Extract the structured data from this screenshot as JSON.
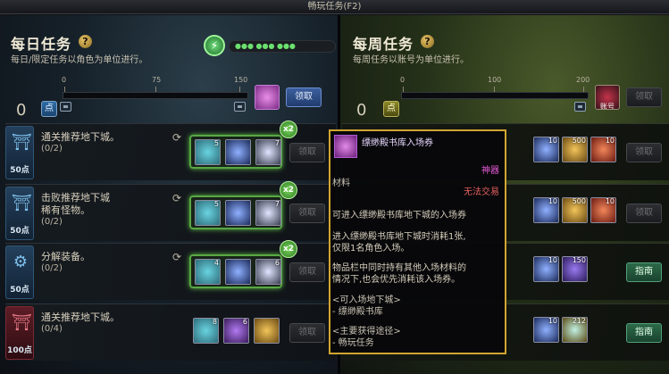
{
  "window": {
    "title": "畅玩任务(F2)"
  },
  "daily": {
    "title": "每日任务",
    "subtitle": "每日/限定任务以角色为单位进行。",
    "points": "0",
    "points_icon_label": "点",
    "ticks": [
      "0",
      "75",
      "150"
    ],
    "claim_label": "领取",
    "progress_dots": "●●● ●●● ●●●"
  },
  "weekly": {
    "title": "每周任务",
    "subtitle": "每周任务以账号为单位进行。",
    "points": "0",
    "points_icon_label": "点",
    "ticks": [
      "0",
      "100",
      "200"
    ],
    "claim_label": "领取",
    "reward_label": "账号"
  },
  "daily_missions": [
    {
      "name": "通关推荐地下城。",
      "progress": "(0/2)",
      "points": "50点",
      "multiplier": "x2",
      "claim": "领取",
      "items": [
        {
          "count": "5"
        },
        {
          "count": ""
        },
        {
          "count": "7"
        }
      ]
    },
    {
      "name": "击败推荐地下城\n稀有怪物。",
      "progress": "(0/2)",
      "points": "50点",
      "multiplier": "x2",
      "claim": "领取",
      "items": [
        {
          "count": "5"
        },
        {
          "count": ""
        },
        {
          "count": "7"
        }
      ]
    },
    {
      "name": "分解装备。",
      "progress": "(0/2)",
      "points": "50点",
      "multiplier": "x2",
      "claim": "领取",
      "items": [
        {
          "count": "4"
        },
        {
          "count": ""
        },
        {
          "count": "6"
        }
      ]
    },
    {
      "name": "通关推荐地下城。",
      "progress": "(0/4)",
      "points": "100点",
      "multiplier": "",
      "claim": "领取",
      "items": [
        {
          "count": "8"
        },
        {
          "count": "6"
        },
        {
          "count": ""
        }
      ]
    }
  ],
  "weekly_missions": [
    {
      "items": [
        {
          "count": "10"
        },
        {
          "count": "500"
        },
        {
          "count": "10"
        }
      ],
      "button": "领取"
    },
    {
      "items": [
        {
          "count": "10"
        },
        {
          "count": "500"
        },
        {
          "count": "10"
        }
      ],
      "button": "领取"
    },
    {
      "items": [
        {
          "count": "10"
        },
        {
          "count": "150"
        }
      ],
      "button": "指南"
    },
    {
      "items": [
        {
          "count": "10"
        },
        {
          "count": "212"
        }
      ],
      "button": "指南"
    }
  ],
  "tooltip": {
    "title": "缥缈殿书库入场券",
    "rarity": "神器",
    "type": "材料",
    "trade": "无法交易",
    "desc1": "可进入缥缈殿书库地下城的入场券",
    "desc2a": "进入缥缈殿书库地下城时消耗1张,",
    "desc2b": "仅限1名角色入场。",
    "desc3a": "物品栏中同时持有其他入场材料的",
    "desc3b": "情况下,也会优先消耗该入场券。",
    "sec1": "<可入场地下城>",
    "sec1a": "- 缥缈殿书库",
    "sec2": "<主要获得途径>",
    "sec2a": "- 畅玩任务"
  },
  "colors": {
    "gold_border": "#d1a530",
    "rarity": "#e85ad8",
    "trade": "#e36060",
    "accent_green": "#58a844"
  }
}
